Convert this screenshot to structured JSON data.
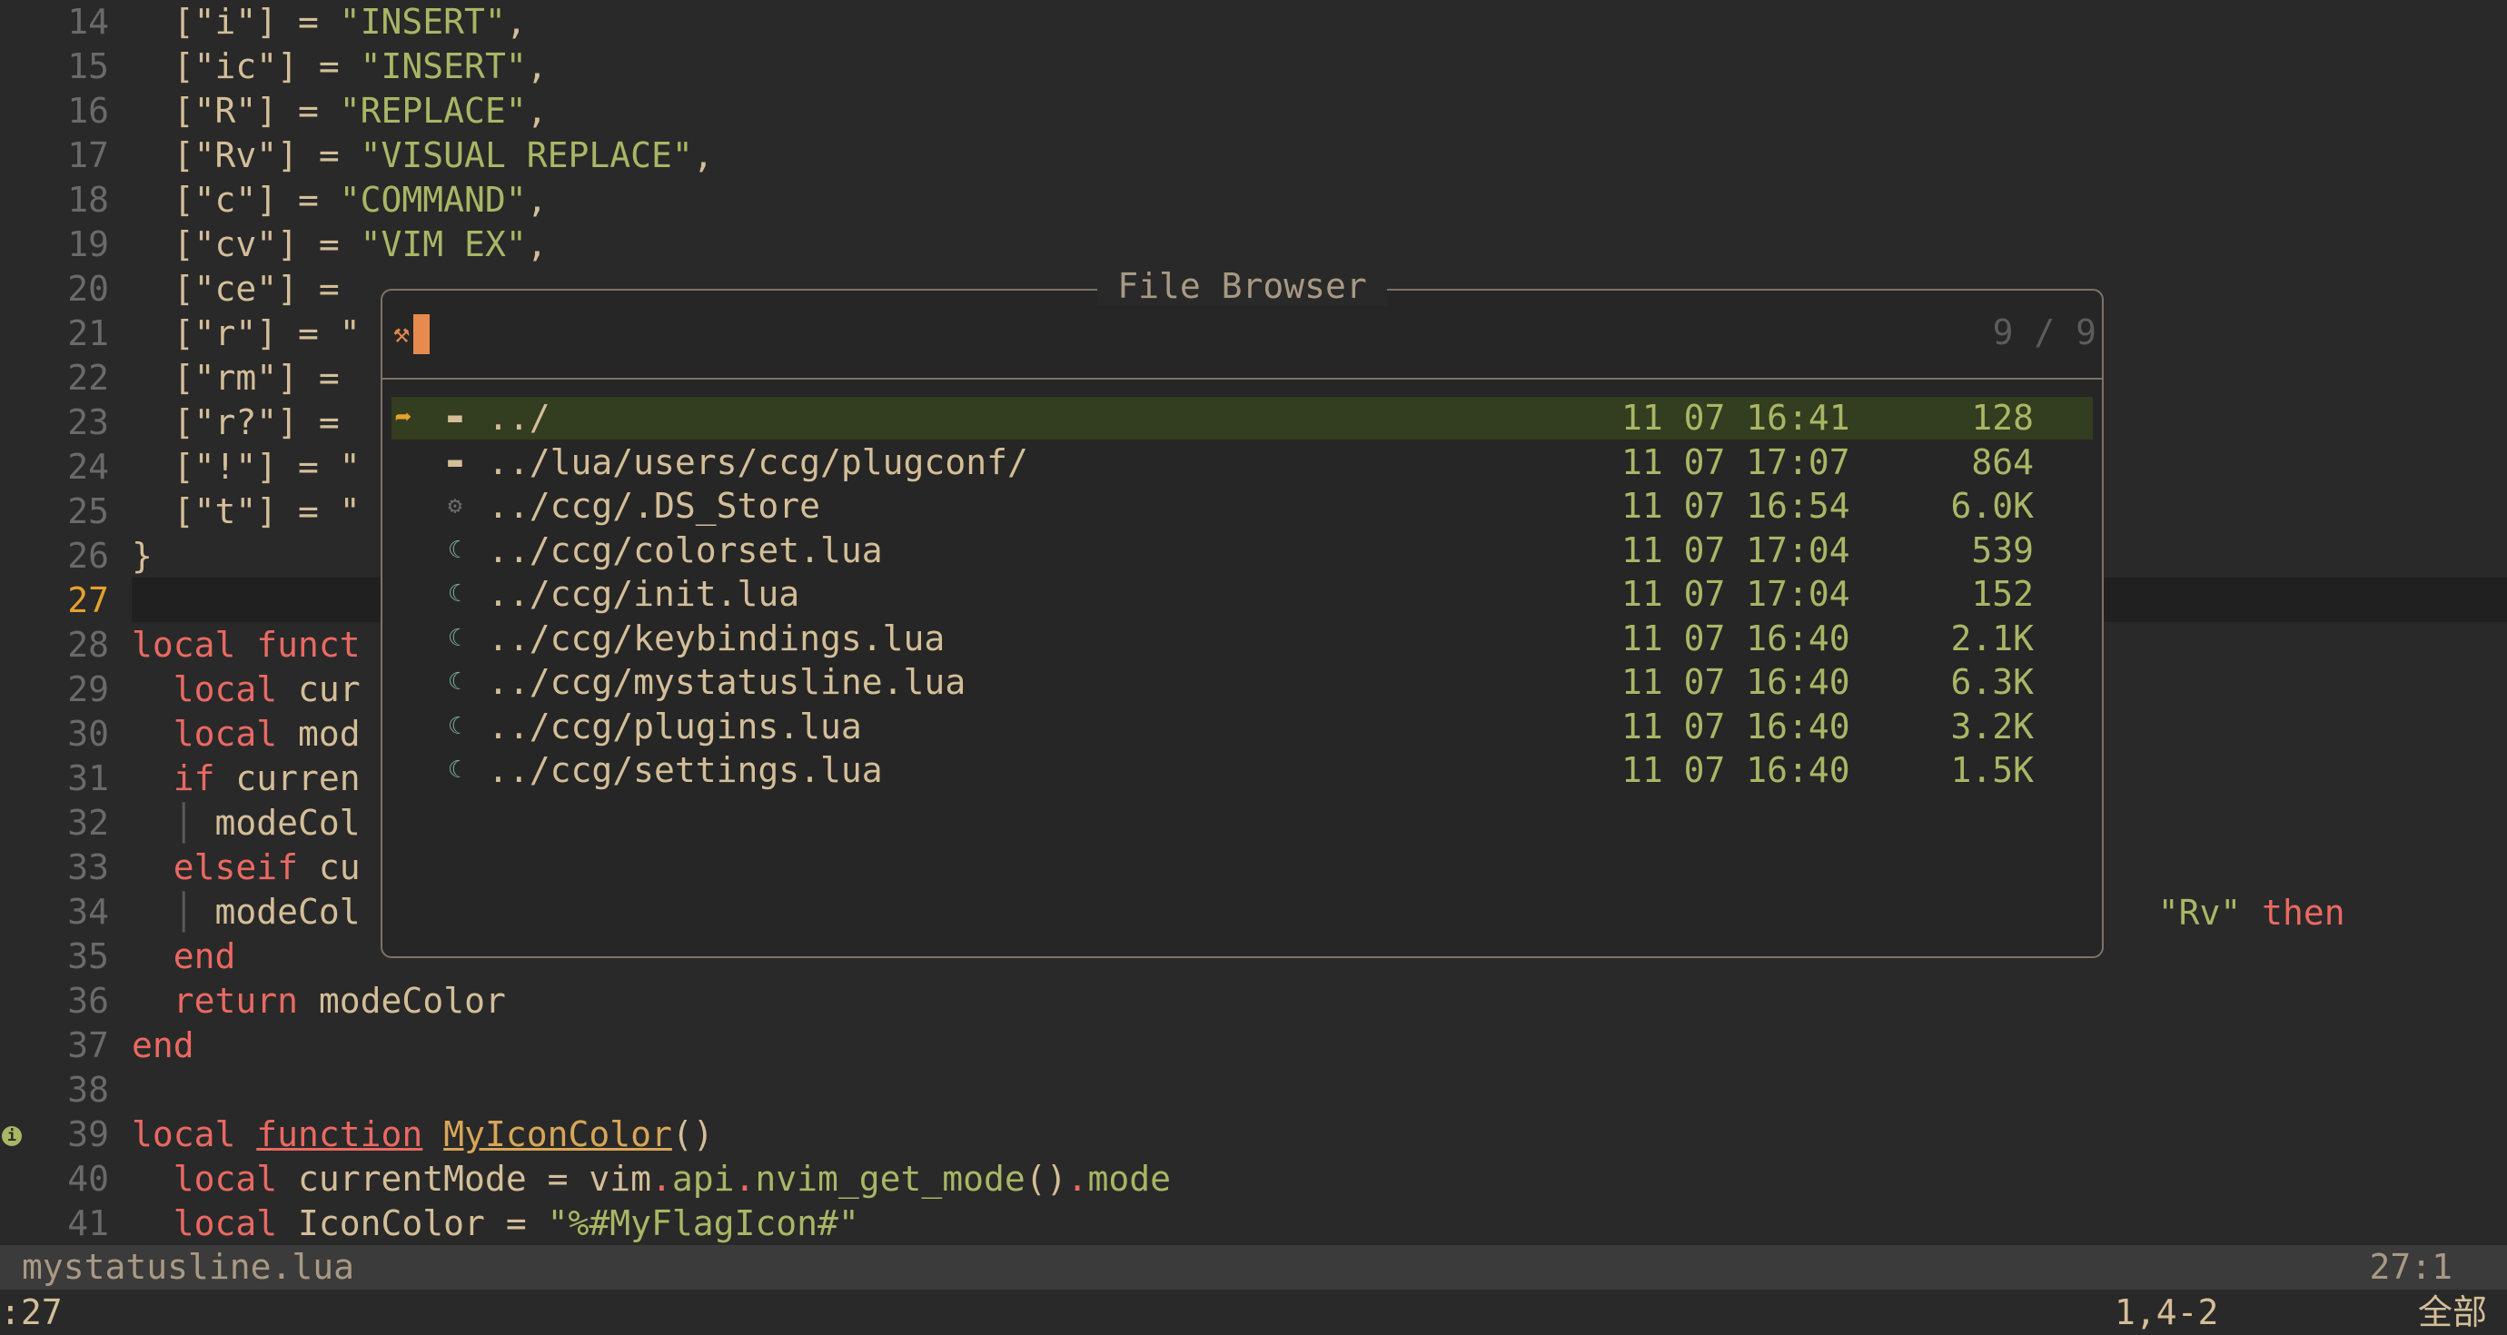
{
  "editor": {
    "lines": [
      {
        "n": "14",
        "parts": [
          {
            "t": "  [\"i\"] = "
          },
          {
            "t": "\"INSERT\"",
            "c": "s"
          },
          {
            "t": ","
          }
        ]
      },
      {
        "n": "15",
        "parts": [
          {
            "t": "  [\"ic\"] = "
          },
          {
            "t": "\"INSERT\"",
            "c": "s"
          },
          {
            "t": ","
          }
        ]
      },
      {
        "n": "16",
        "parts": [
          {
            "t": "  [\"R\"] = "
          },
          {
            "t": "\"REPLACE\"",
            "c": "s"
          },
          {
            "t": ","
          }
        ]
      },
      {
        "n": "17",
        "parts": [
          {
            "t": "  [\"Rv\"] = "
          },
          {
            "t": "\"VISUAL REPLACE\"",
            "c": "s"
          },
          {
            "t": ","
          }
        ]
      },
      {
        "n": "18",
        "parts": [
          {
            "t": "  [\"c\"] = "
          },
          {
            "t": "\"COMMAND\"",
            "c": "s"
          },
          {
            "t": ","
          }
        ]
      },
      {
        "n": "19",
        "parts": [
          {
            "t": "  [\"cv\"] = "
          },
          {
            "t": "\"VIM EX\"",
            "c": "s"
          },
          {
            "t": ","
          }
        ]
      },
      {
        "n": "20",
        "parts": [
          {
            "t": "  [\"ce\"] ="
          }
        ]
      },
      {
        "n": "21",
        "parts": [
          {
            "t": "  [\"r\"] = \""
          }
        ]
      },
      {
        "n": "22",
        "parts": [
          {
            "t": "  [\"rm\"] ="
          }
        ]
      },
      {
        "n": "23",
        "parts": [
          {
            "t": "  [\"r?\"] ="
          }
        ]
      },
      {
        "n": "24",
        "parts": [
          {
            "t": "  [\"!\"] = \""
          }
        ]
      },
      {
        "n": "25",
        "parts": [
          {
            "t": "  [\"t\"] = \""
          }
        ]
      },
      {
        "n": "26",
        "parts": [
          {
            "t": "}"
          }
        ]
      },
      {
        "n": "27",
        "parts": []
      },
      {
        "n": "28",
        "parts": [
          {
            "t": "local",
            "c": "k"
          },
          {
            "t": " "
          },
          {
            "t": "funct",
            "c": "k"
          }
        ]
      },
      {
        "n": "29",
        "parts": [
          {
            "t": "  "
          },
          {
            "t": "local",
            "c": "k"
          },
          {
            "t": " cur"
          }
        ]
      },
      {
        "n": "30",
        "parts": [
          {
            "t": "  "
          },
          {
            "t": "local",
            "c": "k"
          },
          {
            "t": " mod"
          }
        ]
      },
      {
        "n": "31",
        "parts": [
          {
            "t": "  "
          },
          {
            "t": "if",
            "c": "k"
          },
          {
            "t": " curren"
          }
        ]
      },
      {
        "n": "32",
        "parts": [
          {
            "t": "  "
          },
          {
            "t": "│",
            "c": "indent"
          },
          {
            "t": " modeCol"
          }
        ]
      },
      {
        "n": "33",
        "parts": [
          {
            "t": "  "
          },
          {
            "t": "elseif",
            "c": "k"
          },
          {
            "t": " cu"
          }
        ]
      },
      {
        "n": "34",
        "parts": [
          {
            "t": "  "
          },
          {
            "t": "│",
            "c": "indent"
          },
          {
            "t": " modeCol"
          }
        ]
      },
      {
        "n": "35",
        "parts": [
          {
            "t": "  "
          },
          {
            "t": "end",
            "c": "k"
          }
        ]
      },
      {
        "n": "36",
        "parts": [
          {
            "t": "  "
          },
          {
            "t": "return",
            "c": "k"
          },
          {
            "t": " modeColor"
          }
        ]
      },
      {
        "n": "37",
        "parts": [
          {
            "t": "end",
            "c": "k"
          }
        ]
      },
      {
        "n": "38",
        "parts": []
      },
      {
        "n": "39",
        "parts": [
          {
            "t": "local",
            "c": "k"
          },
          {
            "t": " "
          },
          {
            "t": "function",
            "c": "k u"
          },
          {
            "t": " "
          },
          {
            "t": "MyIconColor",
            "c": "fn u"
          },
          {
            "t": "()"
          }
        ]
      },
      {
        "n": "40",
        "parts": [
          {
            "t": "  "
          },
          {
            "t": "local",
            "c": "k"
          },
          {
            "t": " currentMode = vim"
          },
          {
            "t": ".",
            "c": "k"
          },
          {
            "t": "api",
            "c": "f"
          },
          {
            "t": ".",
            "c": "k"
          },
          {
            "t": "nvim_get_mode",
            "c": "f"
          },
          {
            "t": "()"
          },
          {
            "t": ".",
            "c": "k"
          },
          {
            "t": "mode",
            "c": "f"
          }
        ]
      },
      {
        "n": "41",
        "parts": [
          {
            "t": "  "
          },
          {
            "t": "local",
            "c": "k"
          },
          {
            "t": " IconColor = "
          },
          {
            "t": "\"%#MyFlagIcon#\"",
            "c": "s"
          }
        ]
      }
    ],
    "current_line": "27",
    "line33_tail_string": "\"Rv\"",
    "line33_tail_keyword": "then",
    "sign_icon": "info-sign-icon",
    "colors": {
      "bg": "#292929",
      "string": "#a9b665",
      "keyword": "#ea6962",
      "function": "#d8a657",
      "line_current": "#e6a12e"
    }
  },
  "file_browser": {
    "title": "File Browser",
    "counter": "9 / 9",
    "prompt_icon": "telescope-icon",
    "items": [
      {
        "icon": "folder-icon",
        "name": "../",
        "date": "11 07 16:41",
        "size": "128",
        "selected": true
      },
      {
        "icon": "folder-icon",
        "name": "../lua/users/ccg/plugconf/",
        "date": "11 07 17:07",
        "size": "864"
      },
      {
        "icon": "gear-icon",
        "name": "../ccg/.DS_Store",
        "date": "11 07 16:54",
        "size": "6.0K"
      },
      {
        "icon": "lua-icon",
        "name": "../ccg/colorset.lua",
        "date": "11 07 17:04",
        "size": "539"
      },
      {
        "icon": "lua-icon",
        "name": "../ccg/init.lua",
        "date": "11 07 17:04",
        "size": "152"
      },
      {
        "icon": "lua-icon",
        "name": "../ccg/keybindings.lua",
        "date": "11 07 16:40",
        "size": "2.1K"
      },
      {
        "icon": "lua-icon",
        "name": "../ccg/mystatusline.lua",
        "date": "11 07 16:40",
        "size": "6.3K"
      },
      {
        "icon": "lua-icon",
        "name": "../ccg/plugins.lua",
        "date": "11 07 16:40",
        "size": "3.2K"
      },
      {
        "icon": "lua-icon",
        "name": "../ccg/settings.lua",
        "date": "11 07 16:40",
        "size": "1.5K"
      }
    ]
  },
  "statusline": {
    "filename": "mystatusline.lua",
    "position": "27:1"
  },
  "cmdline": {
    "command": ":27",
    "ruler": "1,4-2",
    "percent": "全部"
  }
}
